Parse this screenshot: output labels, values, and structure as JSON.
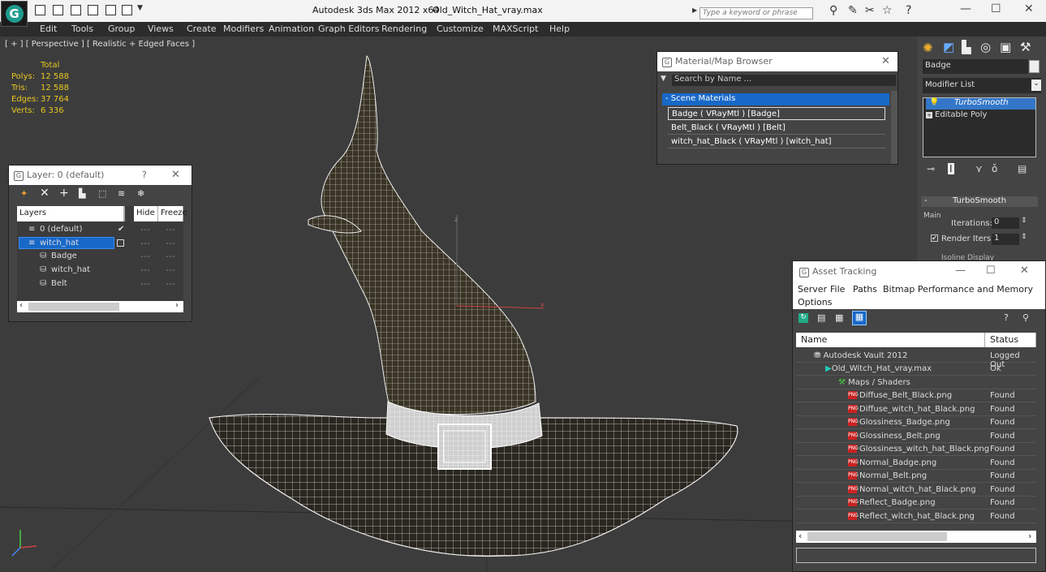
{
  "app": {
    "title": "Autodesk 3ds Max  2012 x64",
    "file": "Old_Witch_Hat_vray.max",
    "search_placeholder": "Type a keyword or phrase"
  },
  "menu": [
    "Edit",
    "Tools",
    "Group",
    "Views",
    "Create",
    "Modifiers",
    "Animation",
    "Graph Editors",
    "Rendering",
    "Customize",
    "MAXScript",
    "Help"
  ],
  "viewport": {
    "label": "[ + ] [ Perspective ] [ Realistic + Edged Faces ]",
    "stats": {
      "header": "Total",
      "rows": [
        {
          "k": "Polys:",
          "v": "12 588"
        },
        {
          "k": "Tris:",
          "v": "12 588"
        },
        {
          "k": "Edges:",
          "v": "37 764"
        },
        {
          "k": "Verts:",
          "v": "6 336"
        }
      ]
    },
    "axis_x": "x",
    "axis_z": "z"
  },
  "layer_panel": {
    "title": "Layer: 0 (default)",
    "help": "?",
    "close": "✕",
    "columns": {
      "layers": "Layers",
      "hide": "Hide",
      "freeze": "Freeze"
    },
    "rows": [
      {
        "name": "0 (default)"
      },
      {
        "name": "witch_hat"
      },
      {
        "name": "Badge"
      },
      {
        "name": "witch_hat"
      },
      {
        "name": "Belt"
      }
    ]
  },
  "material_browser": {
    "title": "Material/Map Browser",
    "close": "✕",
    "search": "Search by Name ...",
    "section": "- Scene Materials",
    "items": [
      "Badge  ( VRayMtl ) [Badge]",
      "Belt_Black  ( VRayMtl ) [Belt]",
      "witch_hat_Black  ( VRayMtl ) [witch_hat]"
    ]
  },
  "command_panel": {
    "object_name": "Badge",
    "modifier_list": "Modifier List",
    "stack": [
      "TurboSmooth",
      "Editable Poly"
    ],
    "rollout": "TurboSmooth",
    "main": "Main",
    "iterations_label": "Iterations:",
    "iterations": "0",
    "render_iters_label": "Render Iters:",
    "render_iters": "1",
    "isoline": "Isoline Display"
  },
  "asset_tracking": {
    "title": "Asset Tracking",
    "menu": [
      "Server",
      "File",
      "Paths",
      "Bitmap Performance and Memory",
      "Options"
    ],
    "columns": {
      "name": "Name",
      "status": "Status"
    },
    "rows": [
      {
        "name": "Autodesk Vault 2012",
        "status": "Logged Out"
      },
      {
        "name": "Old_Witch_Hat_vray.max",
        "status": "Ok"
      },
      {
        "name": "Maps / Shaders",
        "status": ""
      },
      {
        "name": "Diffuse_Belt_Black.png",
        "status": "Found"
      },
      {
        "name": "Diffuse_witch_hat_Black.png",
        "status": "Found"
      },
      {
        "name": "Glossiness_Badge.png",
        "status": "Found"
      },
      {
        "name": "Glossiness_Belt.png",
        "status": "Found"
      },
      {
        "name": "Glossiness_witch_hat_Black.png",
        "status": "Found"
      },
      {
        "name": "Normal_Badge.png",
        "status": "Found"
      },
      {
        "name": "Normal_Belt.png",
        "status": "Found"
      },
      {
        "name": "Normal_witch_hat_Black.png",
        "status": "Found"
      },
      {
        "name": "Reflect_Badge.png",
        "status": "Found"
      },
      {
        "name": "Reflect_witch_hat_Black.png",
        "status": "Found"
      }
    ]
  },
  "colors": {
    "accent": "#1868c8",
    "stats": "#e8c820"
  }
}
